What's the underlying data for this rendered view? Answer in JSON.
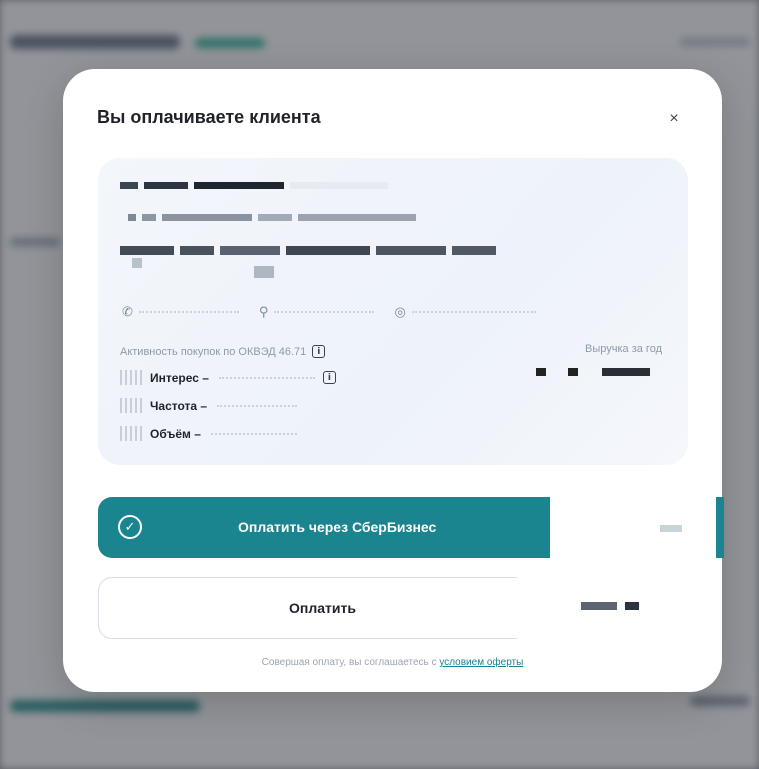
{
  "modal": {
    "title": "Вы оплачиваете клиента",
    "close_glyph": "×"
  },
  "client_card": {
    "activity_label": "Активность покупок по ОКВЭД 46.71",
    "revenue_label": "Выручка за год",
    "metrics": [
      {
        "label": "Интерес –"
      },
      {
        "label": "Частота –"
      },
      {
        "label": "Объём –"
      }
    ],
    "icons": [
      "phone-icon",
      "pin-icon",
      "user-circle-icon",
      "info-icon"
    ]
  },
  "buttons": {
    "pay_sber_label": "Оплатить через СберБизнес",
    "pay_label": "Оплатить"
  },
  "footer": {
    "offer_prefix": "Совершая оплату, вы соглашаетесь с",
    "offer_link": "условием оферты"
  },
  "colors": {
    "accent": "#1a848f",
    "card_bg": "#eef3fa",
    "muted_text": "#8e9aa8"
  }
}
